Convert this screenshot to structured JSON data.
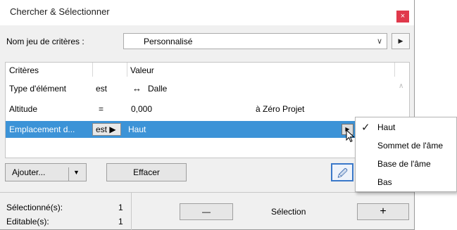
{
  "window": {
    "title": "Chercher & Sélectionner",
    "close": "×"
  },
  "criteria_set": {
    "label": "Nom jeu de critères :",
    "value": "Personnalisé",
    "arrow": "∨",
    "side_button": "▶"
  },
  "table": {
    "headers": {
      "criteria": "Critères",
      "value": "Valeur"
    },
    "rows": [
      {
        "criterion": "Type d'élément",
        "op": "est",
        "icon": "↔",
        "value": "Dalle",
        "extra": ""
      },
      {
        "criterion": "Altitude",
        "op": "=",
        "icon": "",
        "value": "0,000",
        "extra": "à Zéro Projet"
      },
      {
        "criterion": "Emplacement d...",
        "op": "est ▶",
        "icon": "",
        "value": "Haut",
        "extra": "",
        "row_button": "▶"
      }
    ],
    "scroll_up": "∧"
  },
  "buttons": {
    "add": "Ajouter...",
    "add_arrow": "▼",
    "clear": "Effacer",
    "eyedropper": "🖉"
  },
  "footer": {
    "selected_label": "Sélectionné(s):",
    "selected_value": "1",
    "editable_label": "Editable(s):",
    "editable_value": "1",
    "minus": "—",
    "selection": "Sélection",
    "plus": "+"
  },
  "menu": {
    "items": [
      {
        "label": "Haut",
        "checked": "✓"
      },
      {
        "label": "Sommet de l'âme",
        "checked": ""
      },
      {
        "label": "Base de l'âme",
        "checked": ""
      },
      {
        "label": "Bas",
        "checked": ""
      }
    ]
  },
  "colors": {
    "selection": "#3c93d7",
    "close": "#e0394b",
    "accent": "#3a78c9"
  }
}
